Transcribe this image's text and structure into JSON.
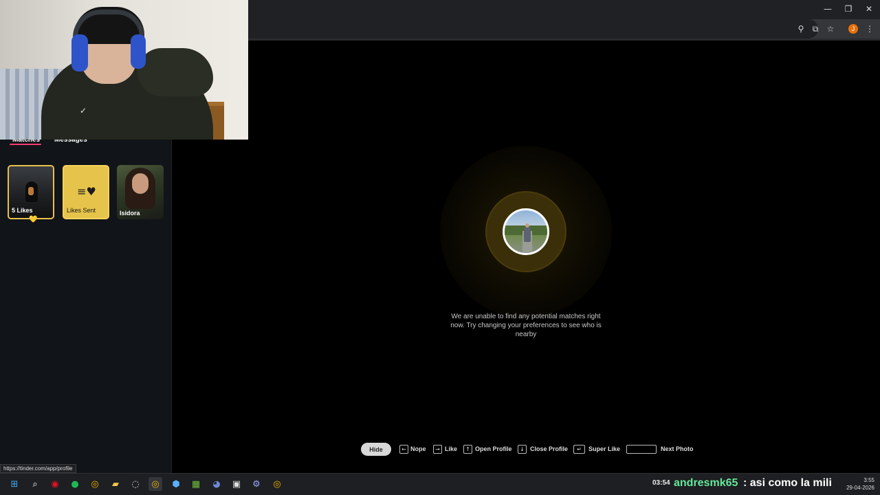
{
  "window": {
    "minimize_glyph": "—",
    "restore_glyph": "❐",
    "close_glyph": "✕"
  },
  "toolbar": {
    "location_icon": "⚲",
    "cast_icon": "⧉",
    "star_icon": "☆",
    "profile_initial": "J",
    "menu_icon": "⋮"
  },
  "sidebar": {
    "tabs": [
      {
        "label": "Matches",
        "active": true
      },
      {
        "label": "Messages",
        "active": false
      }
    ],
    "cards": [
      {
        "label": "5 Likes",
        "type": "likes"
      },
      {
        "label": "Likes Sent",
        "type": "likes-sent",
        "icon": "≡♥"
      },
      {
        "label": "Isidora",
        "type": "match"
      }
    ],
    "heart_badge": "💛"
  },
  "main": {
    "no_matches_text": "We are unable to find any potential matches right now. Try changing your preferences to see who is nearby"
  },
  "shortcuts": {
    "hide_label": "Hide",
    "items": [
      {
        "key": "←",
        "label": "Nope"
      },
      {
        "key": "→",
        "label": "Like"
      },
      {
        "key": "↑",
        "label": "Open Profile"
      },
      {
        "key": "↓",
        "label": "Close Profile"
      },
      {
        "key": "↵",
        "label": "Super Like"
      },
      {
        "key": "",
        "label": "Next Photo"
      }
    ]
  },
  "status_url": "https://tinder.com/app/profile",
  "taskbar": {
    "apps": [
      "windows-start",
      "search",
      "app-red",
      "spotify",
      "chrome",
      "file-explorer",
      "steam-like",
      "chrome-active",
      "steam",
      "minecraft",
      "discord",
      "cursor-app",
      "settings",
      "chrome-2"
    ],
    "chat": {
      "time": "03:54",
      "user": "andresmk65",
      "message": ": asi como la mili"
    },
    "clock": {
      "time": "3:55",
      "date": "29-04-2026"
    }
  },
  "colors": {
    "accent": "#fe3c72",
    "gold": "#e8c250",
    "chat_user": "#66e89a"
  }
}
